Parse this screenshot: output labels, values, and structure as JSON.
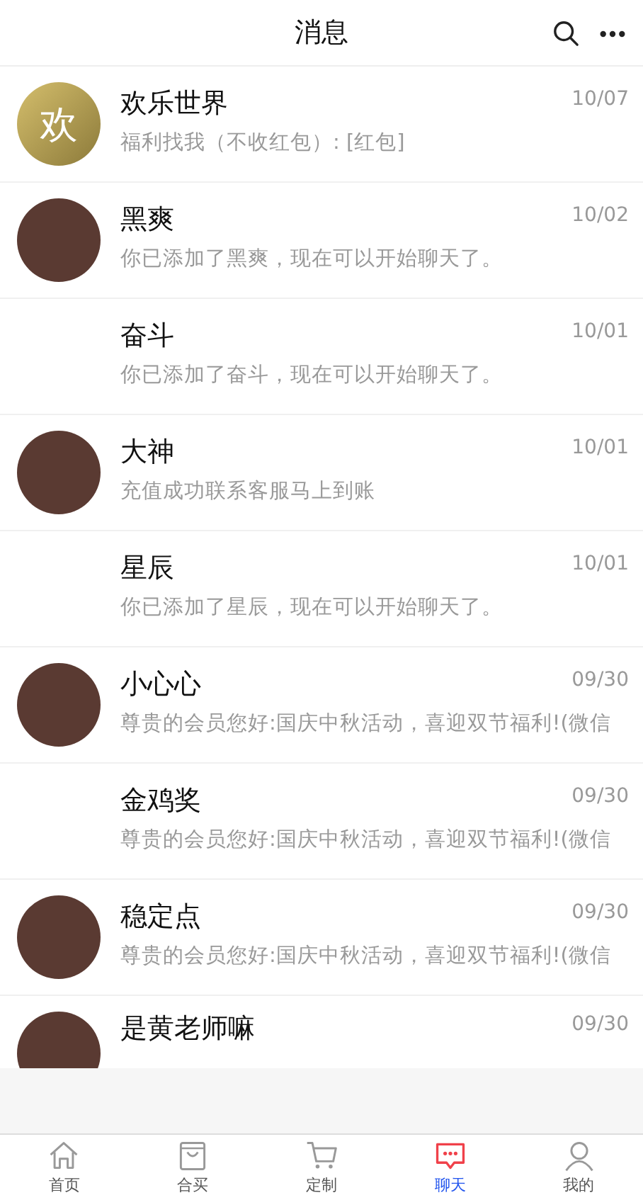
{
  "header": {
    "title": "消息"
  },
  "conversations": [
    {
      "name": "欢乐世界",
      "date": "10/07",
      "message": "福利找我（不收红包）: [红包]",
      "avatar": {
        "kind": "text",
        "text": "欢"
      }
    },
    {
      "name": "黑爽",
      "date": "10/02",
      "message": "你已添加了黑爽，现在可以开始聊天了。",
      "avatar": {
        "kind": "photo"
      }
    },
    {
      "name": "奋斗",
      "date": "10/01",
      "message": "你已添加了奋斗，现在可以开始聊天了。",
      "avatar": {
        "kind": "none"
      }
    },
    {
      "name": "大神",
      "date": "10/01",
      "message": "充值成功联系客服马上到账",
      "avatar": {
        "kind": "photo"
      }
    },
    {
      "name": "星辰",
      "date": "10/01",
      "message": "你已添加了星辰，现在可以开始聊天了。",
      "avatar": {
        "kind": "none"
      }
    },
    {
      "name": "小心心",
      "date": "09/30",
      "message": "尊贵的会员您好:国庆中秋活动，喜迎双节福利!(微信",
      "avatar": {
        "kind": "photo"
      }
    },
    {
      "name": "金鸡奖",
      "date": "09/30",
      "message": "尊贵的会员您好:国庆中秋活动，喜迎双节福利!(微信",
      "avatar": {
        "kind": "none"
      }
    },
    {
      "name": "稳定点",
      "date": "09/30",
      "message": "尊贵的会员您好:国庆中秋活动，喜迎双节福利!(微信",
      "avatar": {
        "kind": "photo"
      }
    },
    {
      "name": "是黄老师嘛",
      "date": "09/30",
      "avatar": {
        "kind": "photo"
      }
    }
  ],
  "tab_bar": [
    {
      "label": "首页",
      "kind": "home",
      "selected": false
    },
    {
      "label": "合买",
      "kind": "bag",
      "selected": false
    },
    {
      "label": "定制",
      "kind": "cart",
      "selected": false
    },
    {
      "label": "聊天",
      "kind": "chat",
      "selected": true
    },
    {
      "label": "我的",
      "kind": "person",
      "selected": false
    }
  ]
}
